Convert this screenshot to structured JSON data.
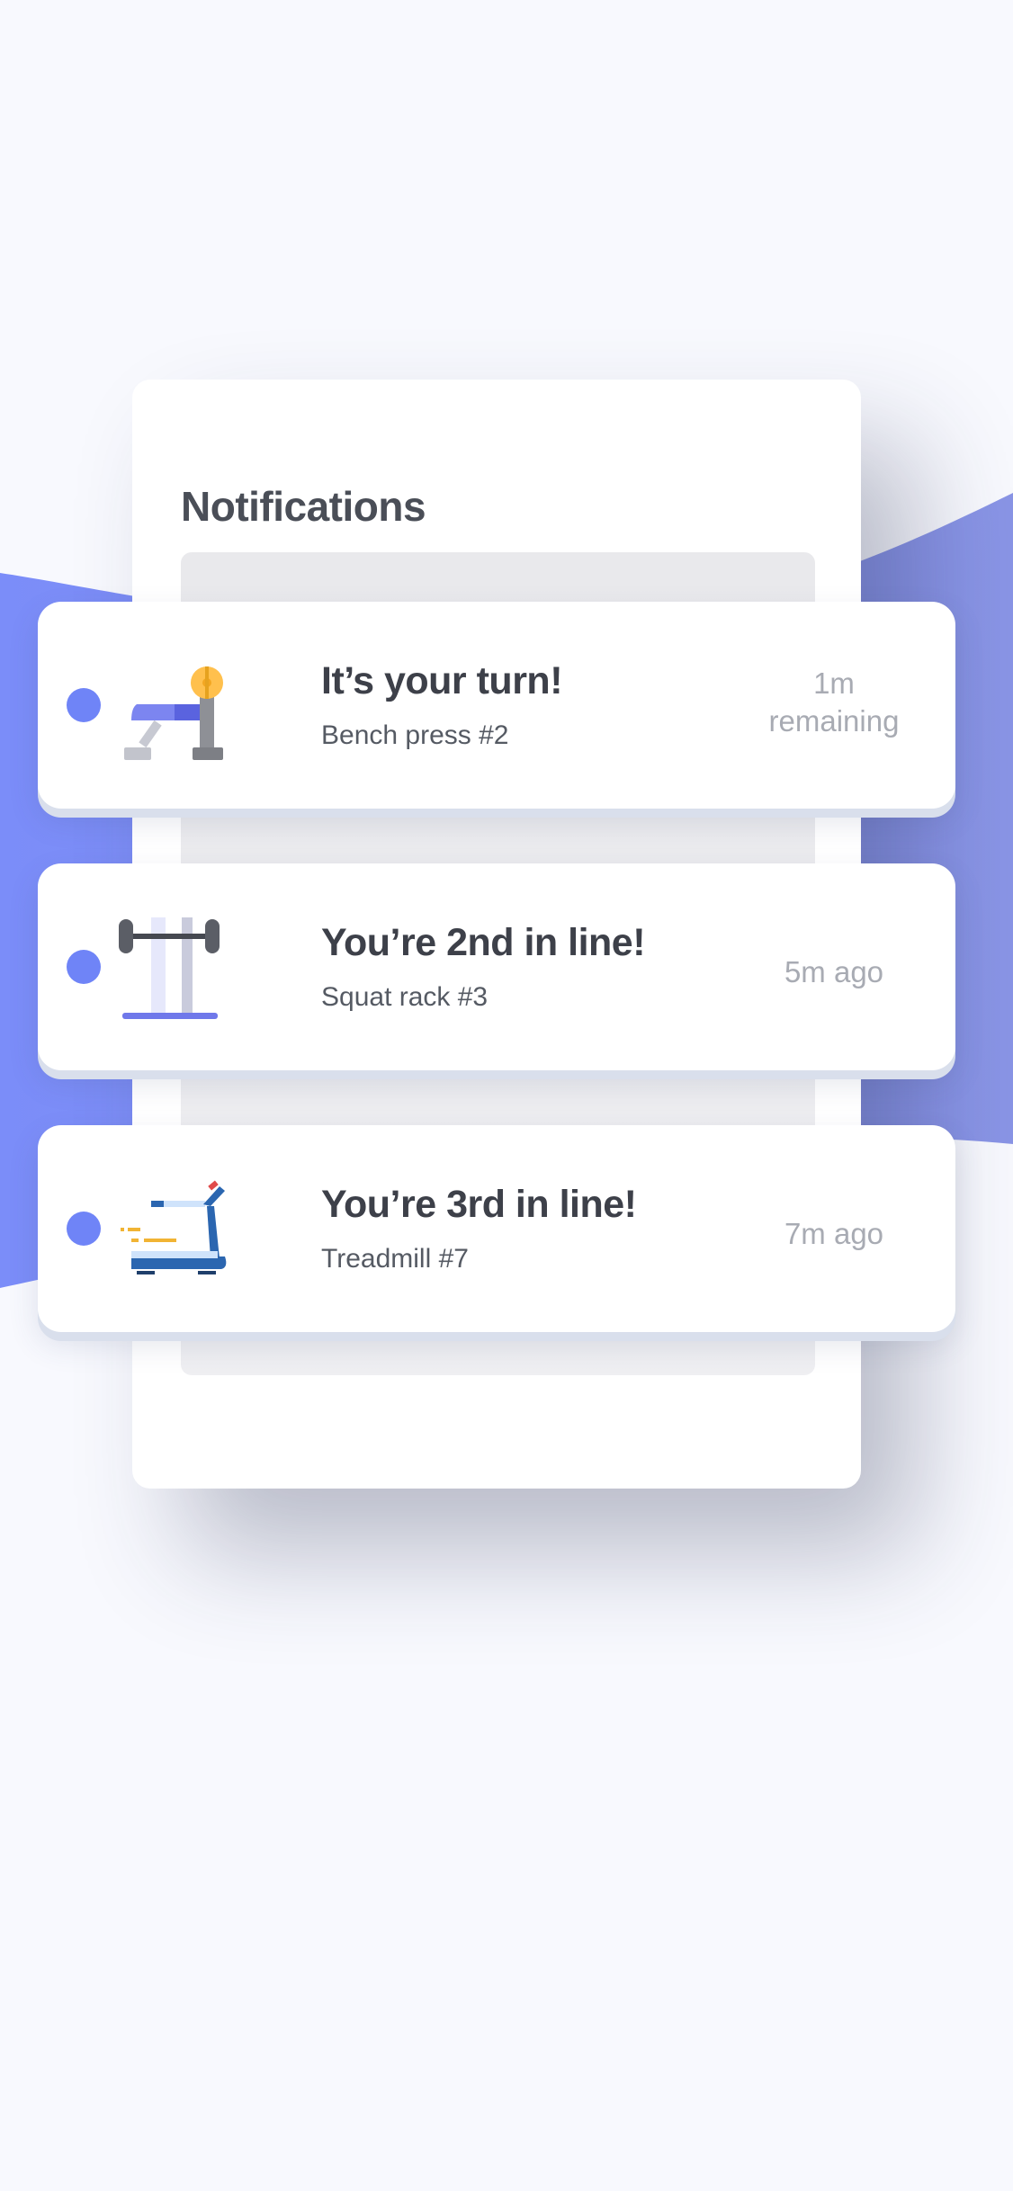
{
  "screen": {
    "title": "Notifications"
  },
  "colors": {
    "accent": "#6f84f7",
    "background": "#f8f9fe",
    "card": "#ffffff",
    "title_text": "#3d4049",
    "time_text": "#a8abb3"
  },
  "notifications": [
    {
      "title": "It’s your turn!",
      "subtitle": "Bench press #2",
      "time_line1": "1m",
      "time_line2": "remaining",
      "icon": "bench-press-icon",
      "unread": true
    },
    {
      "title": "You’re 2nd in line!",
      "subtitle": "Squat rack #3",
      "time": "5m ago",
      "icon": "squat-rack-icon",
      "unread": true
    },
    {
      "title": "You’re 3rd in line!",
      "subtitle": "Treadmill #7",
      "time": "7m ago",
      "icon": "treadmill-icon",
      "unread": true
    }
  ]
}
